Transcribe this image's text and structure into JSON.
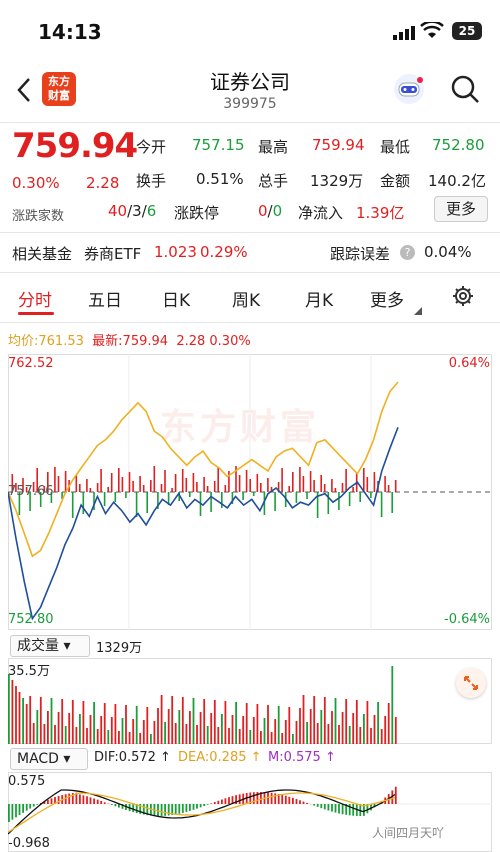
{
  "status": {
    "time": "14:13",
    "battery": "25"
  },
  "header": {
    "logo_line1": "东方",
    "logo_line2": "财富",
    "title": "证券公司",
    "code": "399975"
  },
  "quote": {
    "price": "759.94",
    "change_pct": "0.30%",
    "change": "2.28",
    "open_label": "今开",
    "open": "757.15",
    "high_label": "最高",
    "high": "759.94",
    "low_label": "最低",
    "low": "752.80",
    "turnover_label": "换手",
    "turnover": "0.51%",
    "volume_label": "总手",
    "volume": "1329万",
    "amount_label": "金额",
    "amount": "140.2亿",
    "updown_label": "涨跌家数",
    "up": "40",
    "flat": "3",
    "down": "6",
    "limit_label": "涨跌停",
    "limit_up": "0",
    "limit_down": "0",
    "netflow_label": "净流入",
    "netflow": "1.39亿",
    "more_label": "更多"
  },
  "fund": {
    "label": "相关基金",
    "name": "券商ETF",
    "price": "1.023",
    "pct": "0.29%",
    "tracking_label": "跟踪误差",
    "tracking": "0.04%"
  },
  "tabs": [
    "分时",
    "五日",
    "日K",
    "周K",
    "月K",
    "更多"
  ],
  "chart_info": {
    "avg_label": "均价:",
    "avg": "761.53",
    "latest_label": "最新:",
    "latest": "759.94",
    "chg": "2.28",
    "pct": "0.30%"
  },
  "axis": {
    "top": "762.52",
    "mid": "757.66",
    "bottom": "752.80",
    "top_pct": "0.64%",
    "bottom_pct": "-0.64%"
  },
  "watermark": "东方财富",
  "volume_panel": {
    "selector": "成交量",
    "total": "1329万",
    "max": "35.5万"
  },
  "macd_panel": {
    "selector": "MACD",
    "dif": "DIF:0.572 ↑",
    "dea": "DEA:0.285 ↑",
    "m": "M:0.575 ↑",
    "top": "0.575",
    "bottom": "-0.968"
  },
  "footer_watermark": "人间四月天吖",
  "colors": {
    "up": "#e02020",
    "down": "#1a9e3a",
    "price_line": "#1f4e9a",
    "avg_line": "#f0b020"
  },
  "chart_data": {
    "type": "line",
    "ylim": [
      752.8,
      762.52
    ],
    "series": [
      {
        "name": "最新",
        "values": [
          757.66,
          756.0,
          754.5,
          753.2,
          753.6,
          754.3,
          755.0,
          755.8,
          756.4,
          757.2,
          756.8,
          757.5,
          756.9,
          757.3,
          757.0,
          756.6,
          756.9,
          756.5,
          757.0,
          757.4,
          757.2,
          757.6,
          757.1,
          757.4,
          757.2,
          757.5,
          757.3,
          757.1,
          757.5,
          757.2,
          757.4,
          757.0,
          757.6,
          757.8,
          757.5,
          757.1,
          757.3,
          757.2,
          757.5,
          757.6,
          757.3,
          757.5,
          757.8,
          758.0,
          757.6,
          757.2,
          758.4,
          759.2,
          759.94
        ]
      },
      {
        "name": "均价",
        "values": [
          757.66,
          757.0,
          756.2,
          755.4,
          755.6,
          756.2,
          756.9,
          757.6,
          758.1,
          758.5,
          758.9,
          759.3,
          759.5,
          759.8,
          760.2,
          760.5,
          760.8,
          760.5,
          759.8,
          759.6,
          759.2,
          758.9,
          758.6,
          758.9,
          759.1,
          758.7,
          758.5,
          758.2,
          758.4,
          758.6,
          758.8,
          758.6,
          758.4,
          758.9,
          759.1,
          759.2,
          758.9,
          758.6,
          759.4,
          759.5,
          759.2,
          758.9,
          758.6,
          758.3,
          758.8,
          759.5,
          760.5,
          761.2,
          761.53
        ]
      }
    ]
  }
}
